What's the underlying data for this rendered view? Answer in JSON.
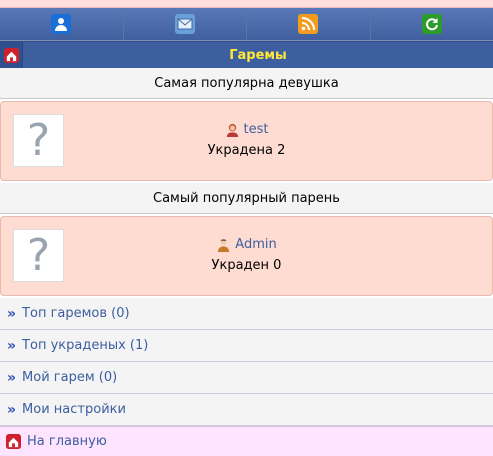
{
  "header": {
    "title": "Гаремы"
  },
  "icon_bar": [
    {
      "icon": "user-icon"
    },
    {
      "icon": "mail-icon"
    },
    {
      "icon": "rss-icon"
    },
    {
      "icon": "refresh-icon"
    }
  ],
  "popular_girl": {
    "heading": "Самая популярна девушка",
    "name": "test",
    "stat": "Украдена 2"
  },
  "popular_guy": {
    "heading": "Самый популярный парень",
    "name": "Admin",
    "stat": "Украден 0"
  },
  "avatar_placeholder": "?",
  "menu": [
    {
      "label": "Топ гаремов (0)"
    },
    {
      "label": "Топ украденых (1)"
    },
    {
      "label": "Мой гарем (0)"
    },
    {
      "label": "Мои настройки"
    }
  ],
  "home_link": "На главную",
  "menu_arrow": "»"
}
